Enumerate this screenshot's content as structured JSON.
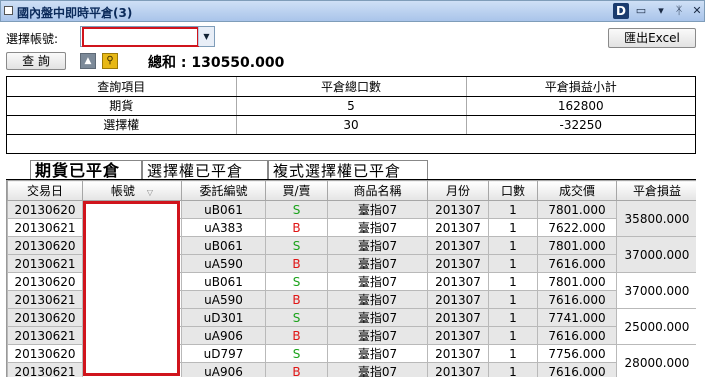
{
  "window": {
    "title": "國內盤中即時平倉(3)",
    "logo_letter": "D",
    "buttons": [
      "▭",
      "▾",
      "ᛡ",
      "✕"
    ]
  },
  "toolbar": {
    "account_label": "選擇帳號:",
    "account_value": "",
    "export_label": "匯出Excel",
    "query_label": "查 詢",
    "total_text": "總和 : 130550.000"
  },
  "summary": {
    "headers": [
      "查詢項目",
      "平倉總口數",
      "平倉損益小計"
    ],
    "rows": [
      [
        "期貨",
        "5",
        "162800"
      ],
      [
        "選擇權",
        "30",
        "-32250"
      ]
    ]
  },
  "tabs": [
    "期貨已平倉",
    "選擇權已平倉",
    "複式選擇權已平倉"
  ],
  "grid": {
    "headers": [
      "交易日",
      "帳號",
      "委託編號",
      "買/賣",
      "商品名稱",
      "月份",
      "口數",
      "成交價",
      "平倉損益"
    ],
    "rows": [
      {
        "date": "20130620",
        "acct": "",
        "order": "uB061",
        "side": "S",
        "product": "臺指07",
        "month": "201307",
        "qty": "1",
        "price": "7801.000"
      },
      {
        "date": "20130621",
        "acct": "",
        "order": "uA383",
        "side": "B",
        "product": "臺指07",
        "month": "201307",
        "qty": "1",
        "price": "7622.000"
      },
      {
        "date": "20130620",
        "acct": "",
        "order": "uB061",
        "side": "S",
        "product": "臺指07",
        "month": "201307",
        "qty": "1",
        "price": "7801.000"
      },
      {
        "date": "20130621",
        "acct": "",
        "order": "uA590",
        "side": "B",
        "product": "臺指07",
        "month": "201307",
        "qty": "1",
        "price": "7616.000"
      },
      {
        "date": "20130620",
        "acct": "",
        "order": "uB061",
        "side": "S",
        "product": "臺指07",
        "month": "201307",
        "qty": "1",
        "price": "7801.000"
      },
      {
        "date": "20130621",
        "acct": "",
        "order": "uA590",
        "side": "B",
        "product": "臺指07",
        "month": "201307",
        "qty": "1",
        "price": "7616.000"
      },
      {
        "date": "20130620",
        "acct": "",
        "order": "uD301",
        "side": "S",
        "product": "臺指07",
        "month": "201307",
        "qty": "1",
        "price": "7741.000"
      },
      {
        "date": "20130621",
        "acct": "",
        "order": "uA906",
        "side": "B",
        "product": "臺指07",
        "month": "201307",
        "qty": "1",
        "price": "7616.000"
      },
      {
        "date": "20130620",
        "acct": "",
        "order": "uD797",
        "side": "S",
        "product": "臺指07",
        "month": "201307",
        "qty": "1",
        "price": "7756.000"
      },
      {
        "date": "20130621",
        "acct": "",
        "order": "uA906",
        "side": "B",
        "product": "臺指07",
        "month": "201307",
        "qty": "1",
        "price": "7616.000"
      }
    ],
    "pnl": [
      "35800.000",
      "37000.000",
      "37000.000",
      "25000.000",
      "28000.000"
    ]
  }
}
